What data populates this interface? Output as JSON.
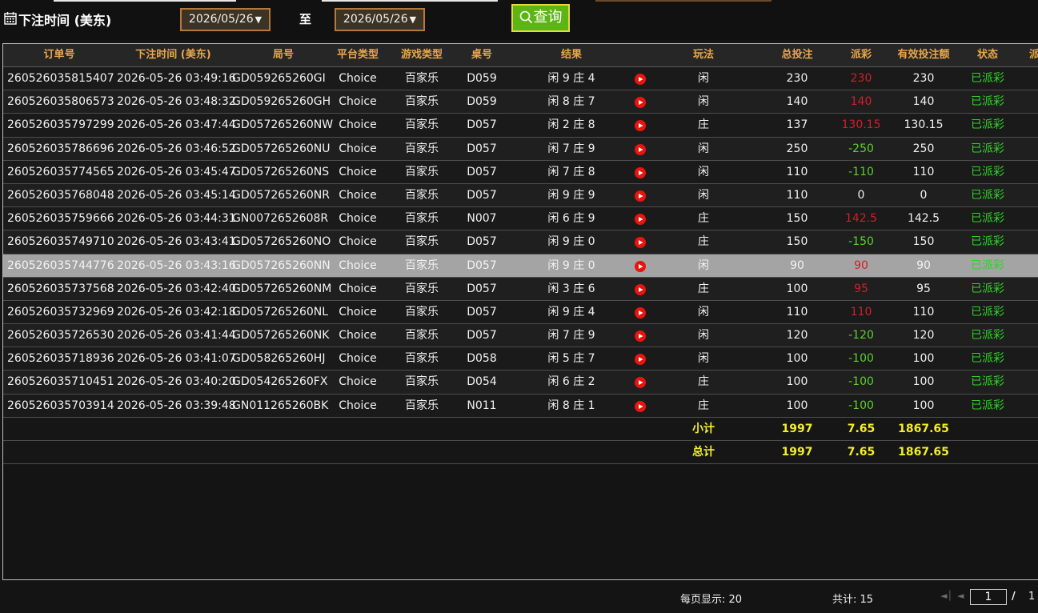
{
  "filter": {
    "label": "下注时间 (美东)",
    "start_date": "2026/05/26",
    "end_date": "2026/05/26",
    "to_label": "至",
    "query_label": "查询",
    "dropdown_arrow": "▼"
  },
  "table": {
    "columns": [
      "订单号",
      "下注时间 (美东)",
      "局号",
      "平台类型",
      "游戏类型",
      "桌号",
      "结果",
      "玩法",
      "总投注",
      "派彩",
      "有效投注额",
      "状态",
      "派"
    ],
    "rows": [
      {
        "order": "260526035815407",
        "time": "2026-05-26 03:49:16",
        "round": "GD059265260GI",
        "platform": "Choice",
        "game": "百家乐",
        "table": "D059",
        "result": "闲 9 庄 4",
        "play": "闲",
        "bet": "230",
        "payout": "230",
        "payout_color": "red",
        "valid": "230",
        "status": "已派彩"
      },
      {
        "order": "260526035806573",
        "time": "2026-05-26 03:48:32",
        "round": "GD059265260GH",
        "platform": "Choice",
        "game": "百家乐",
        "table": "D059",
        "result": "闲 8 庄 7",
        "play": "闲",
        "bet": "140",
        "payout": "140",
        "payout_color": "red",
        "valid": "140",
        "status": "已派彩"
      },
      {
        "order": "260526035797299",
        "time": "2026-05-26 03:47:44",
        "round": "GD057265260NW",
        "platform": "Choice",
        "game": "百家乐",
        "table": "D057",
        "result": "闲 2 庄 8",
        "play": "庄",
        "bet": "137",
        "payout": "130.15",
        "payout_color": "red",
        "valid": "130.15",
        "status": "已派彩"
      },
      {
        "order": "260526035786696",
        "time": "2026-05-26 03:46:52",
        "round": "GD057265260NU",
        "platform": "Choice",
        "game": "百家乐",
        "table": "D057",
        "result": "闲 7 庄 9",
        "play": "闲",
        "bet": "250",
        "payout": "-250",
        "payout_color": "green",
        "valid": "250",
        "status": "已派彩"
      },
      {
        "order": "260526035774565",
        "time": "2026-05-26 03:45:47",
        "round": "GD057265260NS",
        "platform": "Choice",
        "game": "百家乐",
        "table": "D057",
        "result": "闲 7 庄 8",
        "play": "闲",
        "bet": "110",
        "payout": "-110",
        "payout_color": "green",
        "valid": "110",
        "status": "已派彩"
      },
      {
        "order": "260526035768048",
        "time": "2026-05-26 03:45:14",
        "round": "GD057265260NR",
        "platform": "Choice",
        "game": "百家乐",
        "table": "D057",
        "result": "闲 9 庄 9",
        "play": "闲",
        "bet": "110",
        "payout": "0",
        "payout_color": "white",
        "valid": "0",
        "status": "已派彩"
      },
      {
        "order": "260526035759666",
        "time": "2026-05-26 03:44:31",
        "round": "GN0072652608R",
        "platform": "Choice",
        "game": "百家乐",
        "table": "N007",
        "result": "闲 6 庄 9",
        "play": "庄",
        "bet": "150",
        "payout": "142.5",
        "payout_color": "red",
        "valid": "142.5",
        "status": "已派彩"
      },
      {
        "order": "260526035749710",
        "time": "2026-05-26 03:43:41",
        "round": "GD057265260NO",
        "platform": "Choice",
        "game": "百家乐",
        "table": "D057",
        "result": "闲 9 庄 0",
        "play": "庄",
        "bet": "150",
        "payout": "-150",
        "payout_color": "green",
        "valid": "150",
        "status": "已派彩"
      },
      {
        "order": "260526035744776",
        "time": "2026-05-26 03:43:16",
        "round": "GD057265260NN",
        "platform": "Choice",
        "game": "百家乐",
        "table": "D057",
        "result": "闲 9 庄 0",
        "play": "闲",
        "bet": "90",
        "payout": "90",
        "payout_color": "red",
        "valid": "90",
        "status": "已派彩",
        "selected": true
      },
      {
        "order": "260526035737568",
        "time": "2026-05-26 03:42:40",
        "round": "GD057265260NM",
        "platform": "Choice",
        "game": "百家乐",
        "table": "D057",
        "result": "闲 3 庄 6",
        "play": "庄",
        "bet": "100",
        "payout": "95",
        "payout_color": "red",
        "valid": "95",
        "status": "已派彩"
      },
      {
        "order": "260526035732969",
        "time": "2026-05-26 03:42:18",
        "round": "GD057265260NL",
        "platform": "Choice",
        "game": "百家乐",
        "table": "D057",
        "result": "闲 9 庄 4",
        "play": "闲",
        "bet": "110",
        "payout": "110",
        "payout_color": "red",
        "valid": "110",
        "status": "已派彩"
      },
      {
        "order": "260526035726530",
        "time": "2026-05-26 03:41:44",
        "round": "GD057265260NK",
        "platform": "Choice",
        "game": "百家乐",
        "table": "D057",
        "result": "闲 7 庄 9",
        "play": "闲",
        "bet": "120",
        "payout": "-120",
        "payout_color": "green",
        "valid": "120",
        "status": "已派彩"
      },
      {
        "order": "260526035718936",
        "time": "2026-05-26 03:41:07",
        "round": "GD058265260HJ",
        "platform": "Choice",
        "game": "百家乐",
        "table": "D058",
        "result": "闲 5 庄 7",
        "play": "闲",
        "bet": "100",
        "payout": "-100",
        "payout_color": "green",
        "valid": "100",
        "status": "已派彩"
      },
      {
        "order": "260526035710451",
        "time": "2026-05-26 03:40:20",
        "round": "GD054265260FX",
        "platform": "Choice",
        "game": "百家乐",
        "table": "D054",
        "result": "闲 6 庄 2",
        "play": "庄",
        "bet": "100",
        "payout": "-100",
        "payout_color": "green",
        "valid": "100",
        "status": "已派彩"
      },
      {
        "order": "260526035703914",
        "time": "2026-05-26 03:39:48",
        "round": "GN011265260BK",
        "platform": "Choice",
        "game": "百家乐",
        "table": "N011",
        "result": "闲 8 庄 1",
        "play": "庄",
        "bet": "100",
        "payout": "-100",
        "payout_color": "green",
        "valid": "100",
        "status": "已派彩"
      }
    ],
    "subtotal": {
      "label": "小计",
      "bet": "1997",
      "payout": "7.65",
      "valid": "1867.65"
    },
    "total": {
      "label": "总计",
      "bet": "1997",
      "payout": "7.65",
      "valid": "1867.65"
    }
  },
  "footer": {
    "per_page": "每页显示: 20",
    "total": "共计: 15",
    "current_page": "1",
    "separator": "/",
    "page_count": "1"
  },
  "colors": {
    "header_text": "#e9a74b",
    "payout_red": "#d11f2a",
    "payout_green": "#5ccf2c",
    "status_green": "#2fd327",
    "summary_yellow": "#f4ee2c",
    "query_button": "#5cb514",
    "selected_row": "#a4a4a4"
  },
  "icons": {
    "filter": "calendar-icon",
    "query": "search-icon",
    "result_replay": "play-icon",
    "pager_first": "first-page-icon",
    "pager_prev": "prev-page-icon"
  }
}
